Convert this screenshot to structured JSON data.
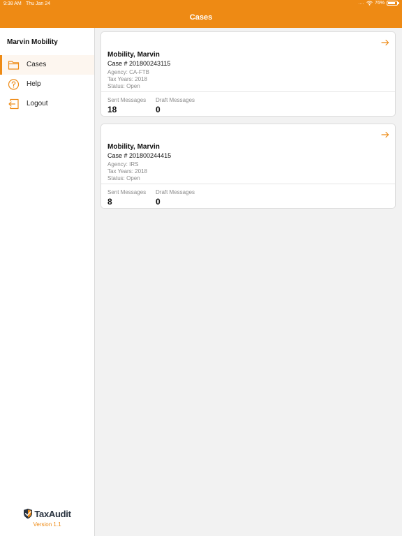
{
  "status_bar": {
    "time": "9:38 AM",
    "date": "Thu Jan 24",
    "signal": "....",
    "battery": "76%"
  },
  "header": {
    "title": "Cases"
  },
  "sidebar": {
    "user_name": "Marvin Mobility",
    "items": [
      {
        "label": "Cases",
        "icon": "folder-icon",
        "active": true
      },
      {
        "label": "Help",
        "icon": "help-icon",
        "active": false
      },
      {
        "label": "Logout",
        "icon": "logout-icon",
        "active": false
      }
    ],
    "brand": "TaxAudit",
    "version": "Version 1.1"
  },
  "cases": [
    {
      "name": "Mobility, Marvin",
      "case_number": "Case # 201800243115",
      "agency": "Agency: CA-FTB",
      "tax_years": "Tax Years: 2018",
      "status": "Status: Open",
      "sent_label": "Sent Messages",
      "sent_count": "18",
      "draft_label": "Draft Messages",
      "draft_count": "0"
    },
    {
      "name": "Mobility, Marvin",
      "case_number": "Case # 201800244415",
      "agency": "Agency: IRS",
      "tax_years": "Tax Years: 2018",
      "status": "Status: Open",
      "sent_label": "Sent Messages",
      "sent_count": "8",
      "draft_label": "Draft Messages",
      "draft_count": "0"
    }
  ],
  "colors": {
    "accent": "#ee8a14",
    "brand_dark": "#2b3440",
    "muted_text": "#8a8a8a"
  }
}
